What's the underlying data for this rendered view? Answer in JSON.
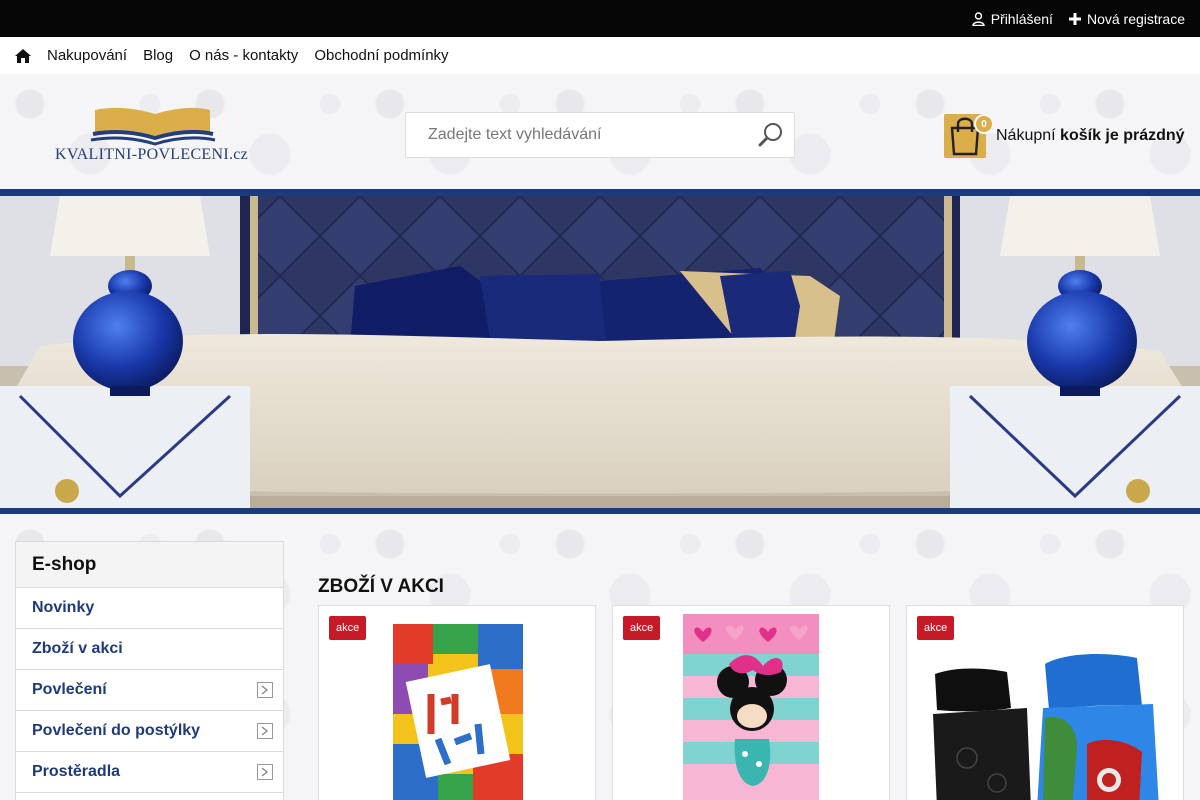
{
  "topbar": {
    "login": "Přihlášení",
    "register": "Nová registrace"
  },
  "nav": {
    "items": [
      "Nakupování",
      "Blog",
      "O nás - kontakty",
      "Obchodní podmínky"
    ]
  },
  "header": {
    "logo_text": "KVALITNI-POVLECENI.cz",
    "search_placeholder": "Zadejte text vyhledávání",
    "cart_count": "0",
    "cart_label": "Nákupní",
    "cart_status": "košík je prázdný"
  },
  "sidebar": {
    "title": "E-shop",
    "items": [
      {
        "label": "Novinky",
        "has_submenu": false
      },
      {
        "label": "Zboží v akci",
        "has_submenu": false
      },
      {
        "label": "Povlečení",
        "has_submenu": true
      },
      {
        "label": "Povlečení do postýlky",
        "has_submenu": true
      },
      {
        "label": "Prostěradla",
        "has_submenu": true
      }
    ]
  },
  "products": {
    "section_title": "ZBOŽÍ V AKCI",
    "items": [
      {
        "tag": "akce",
        "image": "lego-towel"
      },
      {
        "tag": "akce",
        "image": "minnie-towel"
      },
      {
        "tag": "akce",
        "image": "avengers-bedding"
      }
    ]
  },
  "colors": {
    "brand_blue": "#1e3a7b",
    "accent_gold": "#dcae4a",
    "sale_red": "#c61b26",
    "topbar": "#060606"
  }
}
